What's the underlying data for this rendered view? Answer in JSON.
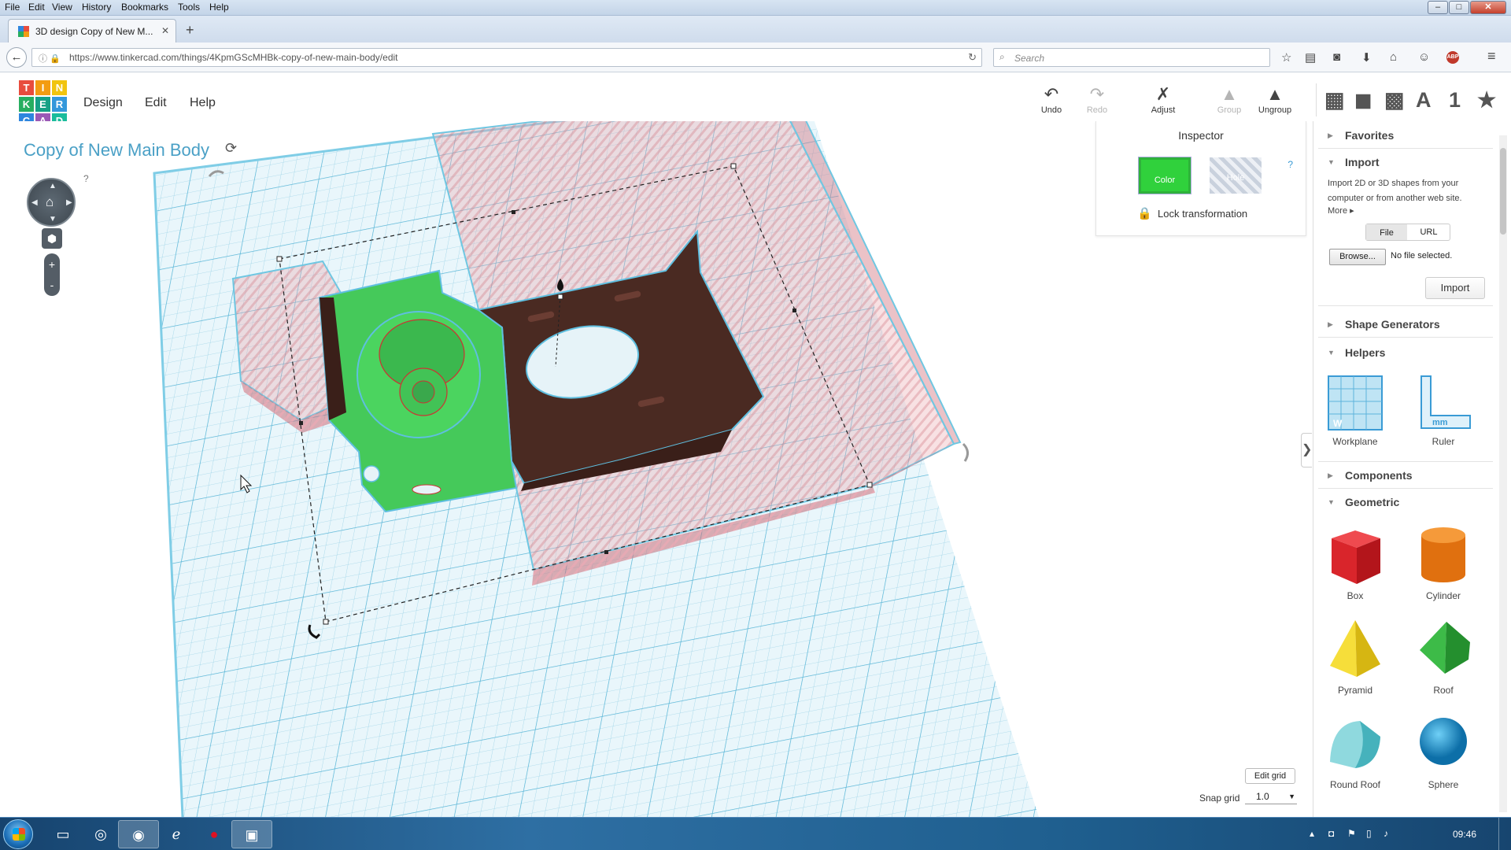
{
  "browser": {
    "menu": [
      "File",
      "Edit",
      "View",
      "History",
      "Bookmarks",
      "Tools",
      "Help"
    ],
    "window_controls": {
      "minimize": "–",
      "maximize": "□",
      "close": "✕"
    },
    "tab": {
      "title": "3D design Copy of New M...",
      "close": "✕",
      "new_tab": "+"
    },
    "back": "←",
    "url": "https://www.tinkercad.com/things/4KpmGScMHBk-copy-of-new-main-body/edit",
    "url_prefix_icons": "ⓘ 🔒",
    "reload": "↻",
    "search_placeholder": "Search",
    "search_icon": "⌕",
    "toolbar_icons": [
      {
        "name": "bookmark-star-icon",
        "glyph": "☆"
      },
      {
        "name": "reading-list-icon",
        "glyph": "▤"
      },
      {
        "name": "pocket-icon",
        "glyph": "◙"
      },
      {
        "name": "downloads-icon",
        "glyph": "⬇"
      },
      {
        "name": "home-icon",
        "glyph": "⌂"
      },
      {
        "name": "chat-icon",
        "glyph": "☺"
      },
      {
        "name": "hamburger-menu-icon",
        "glyph": "≡"
      }
    ],
    "abp_label": "ABP"
  },
  "app": {
    "logo_letters": [
      "T",
      "I",
      "N",
      "K",
      "E",
      "R",
      "C",
      "A",
      "D"
    ],
    "logo_colors": [
      "#e84c3d",
      "#f39c12",
      "#f1c40f",
      "#27ae60",
      "#16a085",
      "#3498db",
      "#2e86de",
      "#9b59b6",
      "#1abc9c"
    ],
    "menus": [
      "Design",
      "Edit",
      "Help"
    ],
    "tools": [
      {
        "name": "undo",
        "label": "Undo",
        "glyph": "↶",
        "enabled": true
      },
      {
        "name": "redo",
        "label": "Redo",
        "glyph": "↷",
        "enabled": false
      },
      {
        "name": "adjust",
        "label": "Adjust",
        "glyph": "✗",
        "enabled": true
      },
      {
        "name": "group",
        "label": "Group",
        "glyph": "▲",
        "enabled": false
      },
      {
        "name": "ungroup",
        "label": "Ungroup",
        "glyph": "▲",
        "enabled": true
      }
    ],
    "view_tools": [
      {
        "name": "workplane-view-icon",
        "glyph": "▦"
      },
      {
        "name": "cube-view-icon",
        "glyph": "◼"
      },
      {
        "name": "wireframe-view-icon",
        "glyph": "▩"
      },
      {
        "name": "text-tool-icon",
        "glyph": "A"
      },
      {
        "name": "number-tool-icon",
        "glyph": "1"
      },
      {
        "name": "favorites-star-icon",
        "glyph": "★"
      }
    ]
  },
  "workspace": {
    "design_title": "Copy of New Main Body",
    "rename_icon": "⟳",
    "view_help": "?",
    "home_glyph": "⌂",
    "cube_glyph": "⬢",
    "zoom_in": "+",
    "zoom_out": "-",
    "edit_grid": "Edit grid",
    "snap_grid_label": "Snap grid",
    "snap_grid_value": "1.0",
    "panel_toggle": "❯"
  },
  "inspector": {
    "title": "Inspector",
    "color_label": "Color",
    "hole_label": "Hole",
    "help": "?",
    "lock_icon": "🔒",
    "lock_label": "Lock transformation"
  },
  "library": {
    "sections": {
      "favorites": "Favorites",
      "import": "Import",
      "shape_generators": "Shape Generators",
      "helpers": "Helpers",
      "components": "Components",
      "geometric": "Geometric"
    },
    "import_desc": "Import 2D or 3D shapes from your computer or from another web site.",
    "import_more": "More ▸",
    "tab_file": "File",
    "tab_url": "URL",
    "browse": "Browse...",
    "no_file": "No file selected.",
    "import_button": "Import",
    "helpers": [
      "Workplane",
      "Ruler"
    ],
    "geometric": [
      "Box",
      "Cylinder",
      "Pyramid",
      "Roof",
      "Round Roof",
      "Sphere"
    ],
    "colors": {
      "box": "#d9252b",
      "cylinder": "#ef7d1a",
      "pyramid": "#f3d21e",
      "roof": "#2fa33a",
      "round_roof": "#53c0c8",
      "sphere": "#1b9ad6"
    }
  },
  "taskbar": {
    "apps": [
      {
        "name": "explorer-icon",
        "glyph": "▭"
      },
      {
        "name": "chrome-icon",
        "glyph": "◎"
      },
      {
        "name": "firefox-icon",
        "glyph": "◉"
      },
      {
        "name": "ie-icon",
        "glyph": "ℯ"
      },
      {
        "name": "media-icon",
        "glyph": "●"
      },
      {
        "name": "app-window-icon",
        "glyph": "▣"
      }
    ],
    "clock": "09:46",
    "tray": [
      "▴",
      "◘",
      "⚑",
      "▯",
      "♪"
    ]
  }
}
